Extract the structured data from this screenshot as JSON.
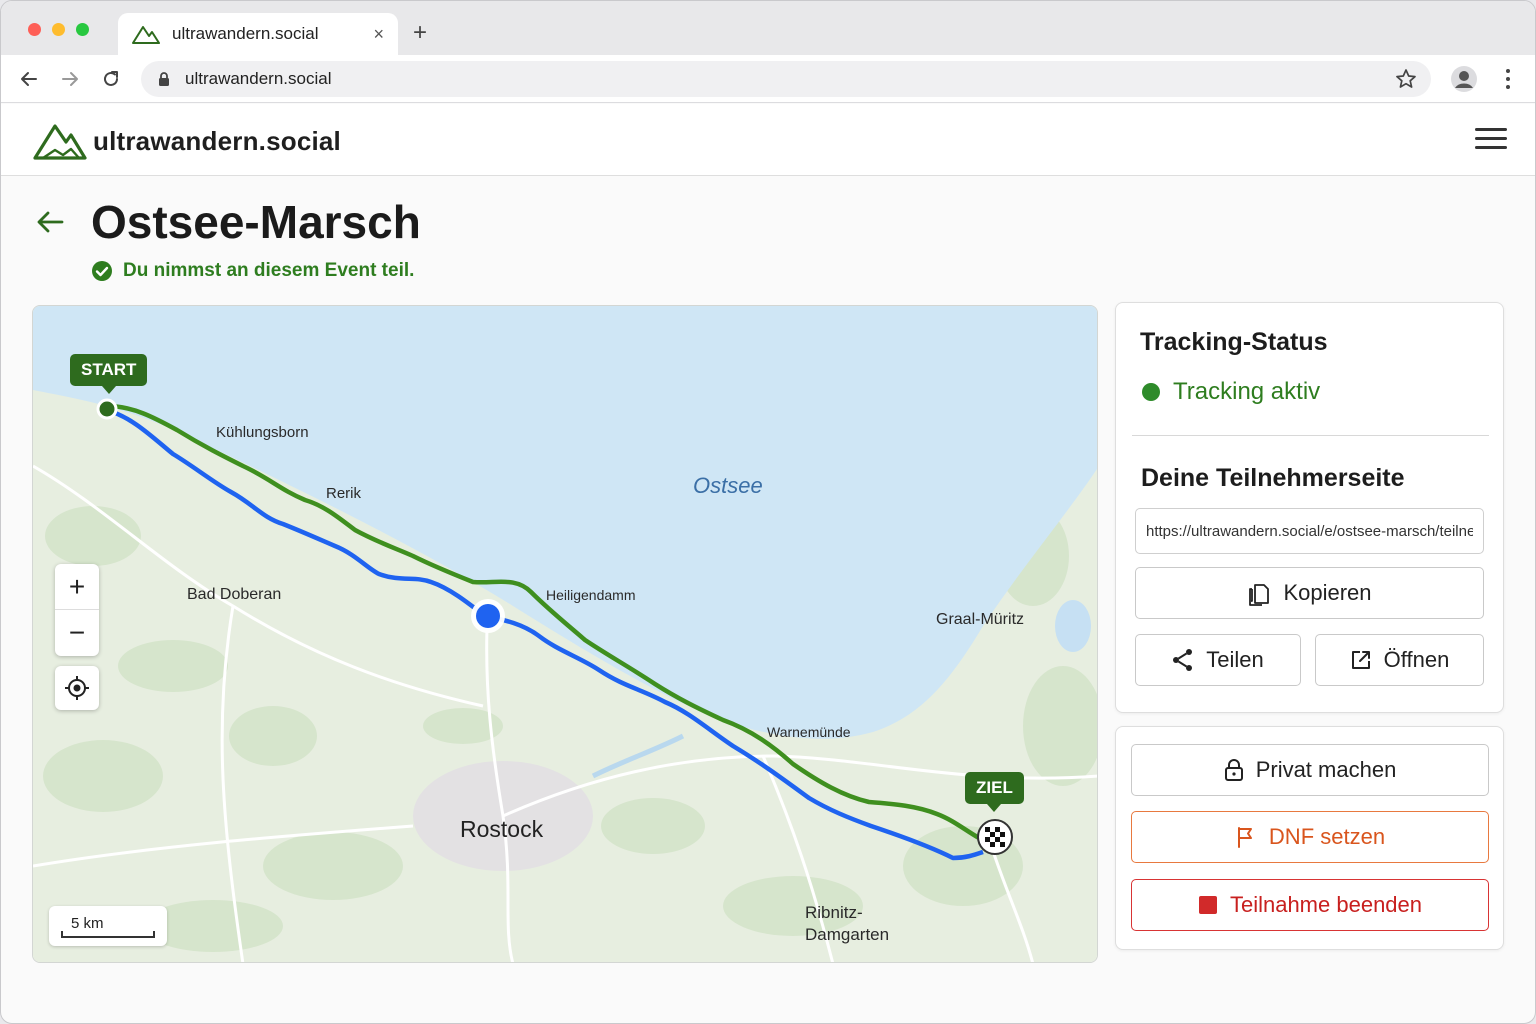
{
  "browser": {
    "tab_title": "ultrawandern.social",
    "url": "ultrawandern.social",
    "new_tab_symbol": "+",
    "close_symbol": "×"
  },
  "site": {
    "brand": "ultrawandern.social",
    "brand_color": "#2e6b1e"
  },
  "event": {
    "title": "Ostsee-Marsch",
    "participation_note": "Du nimmst an diesem Event teil."
  },
  "map": {
    "sea_label": "Ostsee",
    "places": [
      {
        "id": "kuehlungsborn",
        "name": "Kühlungsborn"
      },
      {
        "id": "rerik",
        "name": "Rerik"
      },
      {
        "id": "bad-doberan",
        "name": "Bad Doberan"
      },
      {
        "id": "heiligendamm",
        "name": "Heiligendamm"
      },
      {
        "id": "graal-mueritz",
        "name": "Graal-Müritz"
      },
      {
        "id": "warnemuende",
        "name": "Warnemünde"
      },
      {
        "id": "rostock",
        "name": "Rostock"
      },
      {
        "id": "ribnitz-1",
        "name": "Ribnitz-"
      },
      {
        "id": "ribnitz-2",
        "name": "Damgarten"
      }
    ],
    "start_label": "START",
    "finish_label": "ZIEL",
    "zoom_in": "+",
    "zoom_out": "−",
    "scale": "5 km",
    "colors": {
      "planned_route": "#3f8f1f",
      "tracked_route": "#1f63f0",
      "current_position": "#1f63f0",
      "water": "#cfe6f5",
      "land": "#e6eddf"
    }
  },
  "tracking": {
    "heading": "Tracking-Status",
    "status": "Tracking aktiv",
    "status_color": "#2e8b2a"
  },
  "participant_page": {
    "heading": "Deine Teilnehmerseite",
    "url": "https://ultrawandern.social/e/ostsee-marsch/teilneh",
    "copy_label": "Kopieren",
    "share_label": "Teilen",
    "open_label": "Öffnen"
  },
  "actions": {
    "private_label": "Privat machen",
    "dnf_label": "DNF setzen",
    "end_label": "Teilnahme beenden",
    "dnf_color": "#d9551d",
    "end_color": "#c8201f"
  }
}
